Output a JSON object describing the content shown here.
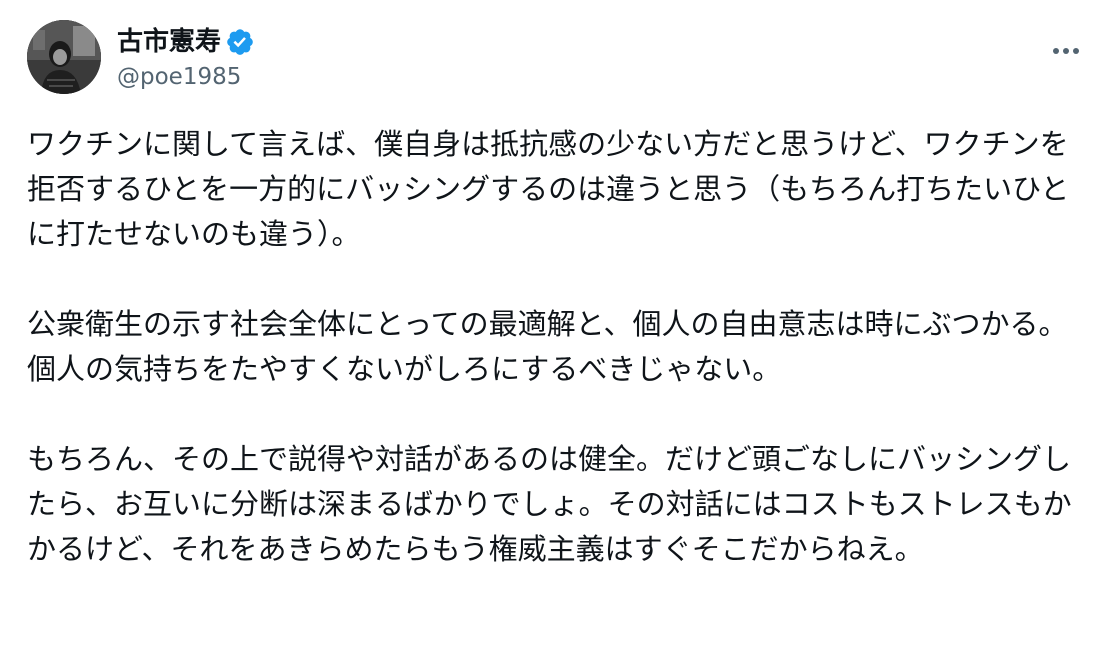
{
  "author": {
    "display_name": "古市憲寿",
    "handle": "@poe1985",
    "verified": true
  },
  "icons": {
    "verified": "verified-badge-icon",
    "more": "more-options-icon"
  },
  "colors": {
    "verified_blue": "#1d9bf0",
    "text_primary": "#0f1419",
    "text_secondary": "#536471"
  },
  "tweet": {
    "paragraphs": [
      "ワクチンに関して言えば、僕自身は抵抗感の少ない方だと思うけど、ワクチンを拒否するひとを一方的にバッシングするのは違うと思う（もちろん打ちたいひとに打たせないのも違う）。",
      "公衆衛生の示す社会全体にとっての最適解と、個人の自由意志は時にぶつかる。個人の気持ちをたやすくないがしろにするべきじゃない。",
      "もちろん、その上で説得や対話があるのは健全。だけど頭ごなしにバッシングしたら、お互いに分断は深まるばかりでしょ。その対話にはコストもストレスもかかるけど、それをあきらめたらもう権威主義はすぐそこだからねえ。"
    ]
  }
}
